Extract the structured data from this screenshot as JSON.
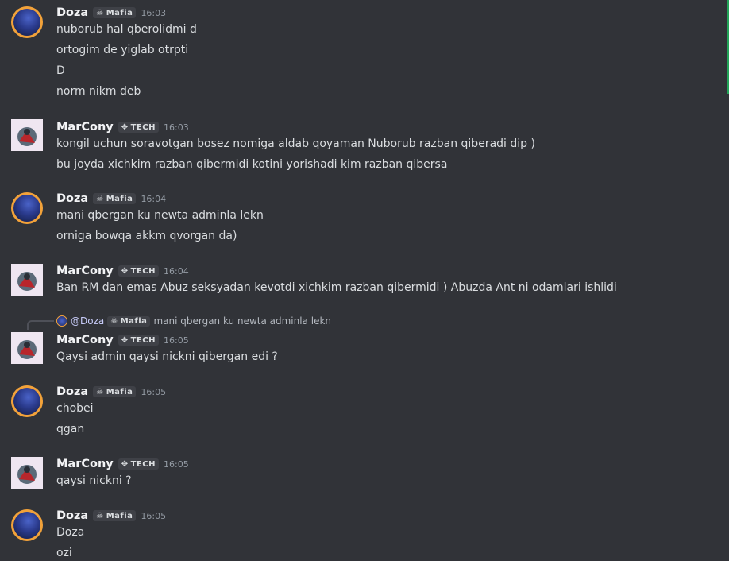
{
  "users": {
    "doza": {
      "name": "Doza",
      "tag": "Mafia",
      "tag_icon": "skull-icon"
    },
    "marcony": {
      "name": "MarCony",
      "tag": "TECH",
      "tag_icon": "gamepad-icon"
    }
  },
  "messages": [
    {
      "author": "Doza",
      "tag": "Mafia",
      "time": "16:03",
      "lines": [
        "nuborub hal qberolidmi d",
        "ortogim de yiglab otrpti",
        "D",
        "norm nikm deb"
      ]
    },
    {
      "author": "MarCony",
      "tag": "TECH",
      "time": "16:03",
      "lines": [
        "kongil uchun soravotgan bosez nomiga aldab qoyaman Nuborub razban qiberadi dip )",
        "bu joyda xichkim razban qibermidi kotini yorishadi kim razban qibersa"
      ]
    },
    {
      "author": "Doza",
      "tag": "Mafia",
      "time": "16:04",
      "lines": [
        "mani qbergan ku newta adminla lekn",
        "orniga bowqa akkm qvorgan da)"
      ]
    },
    {
      "author": "MarCony",
      "tag": "TECH",
      "time": "16:04",
      "lines": [
        "Ban RM dan emas Abuz seksyadan kevotdi xichkim razban qibermidi ) Abuzda Ant ni odamlari ishlidi"
      ]
    },
    {
      "author": "MarCony",
      "tag": "TECH",
      "time": "16:05",
      "lines": [
        "Qaysi admin qaysi nickni qibergan edi  ?"
      ]
    },
    {
      "author": "Doza",
      "tag": "Mafia",
      "time": "16:05",
      "lines": [
        "chobei",
        "qgan"
      ]
    },
    {
      "author": "MarCony",
      "tag": "TECH",
      "time": "16:05",
      "lines": [
        "qaysi nickni  ?"
      ]
    },
    {
      "author": "Doza",
      "tag": "Mafia",
      "time": "16:05",
      "lines": [
        "Doza",
        "ozi"
      ]
    }
  ],
  "reply": {
    "mention": "@Doza",
    "tag": "Mafia",
    "text": "mani qbergan ku newta adminla lekn"
  },
  "colors": {
    "background": "#313338",
    "text": "#dbdee1",
    "username": "#f2f3f5",
    "timestamp": "#949ba4",
    "tag_bg": "#3f4147",
    "scrollbar": "#23a559"
  }
}
